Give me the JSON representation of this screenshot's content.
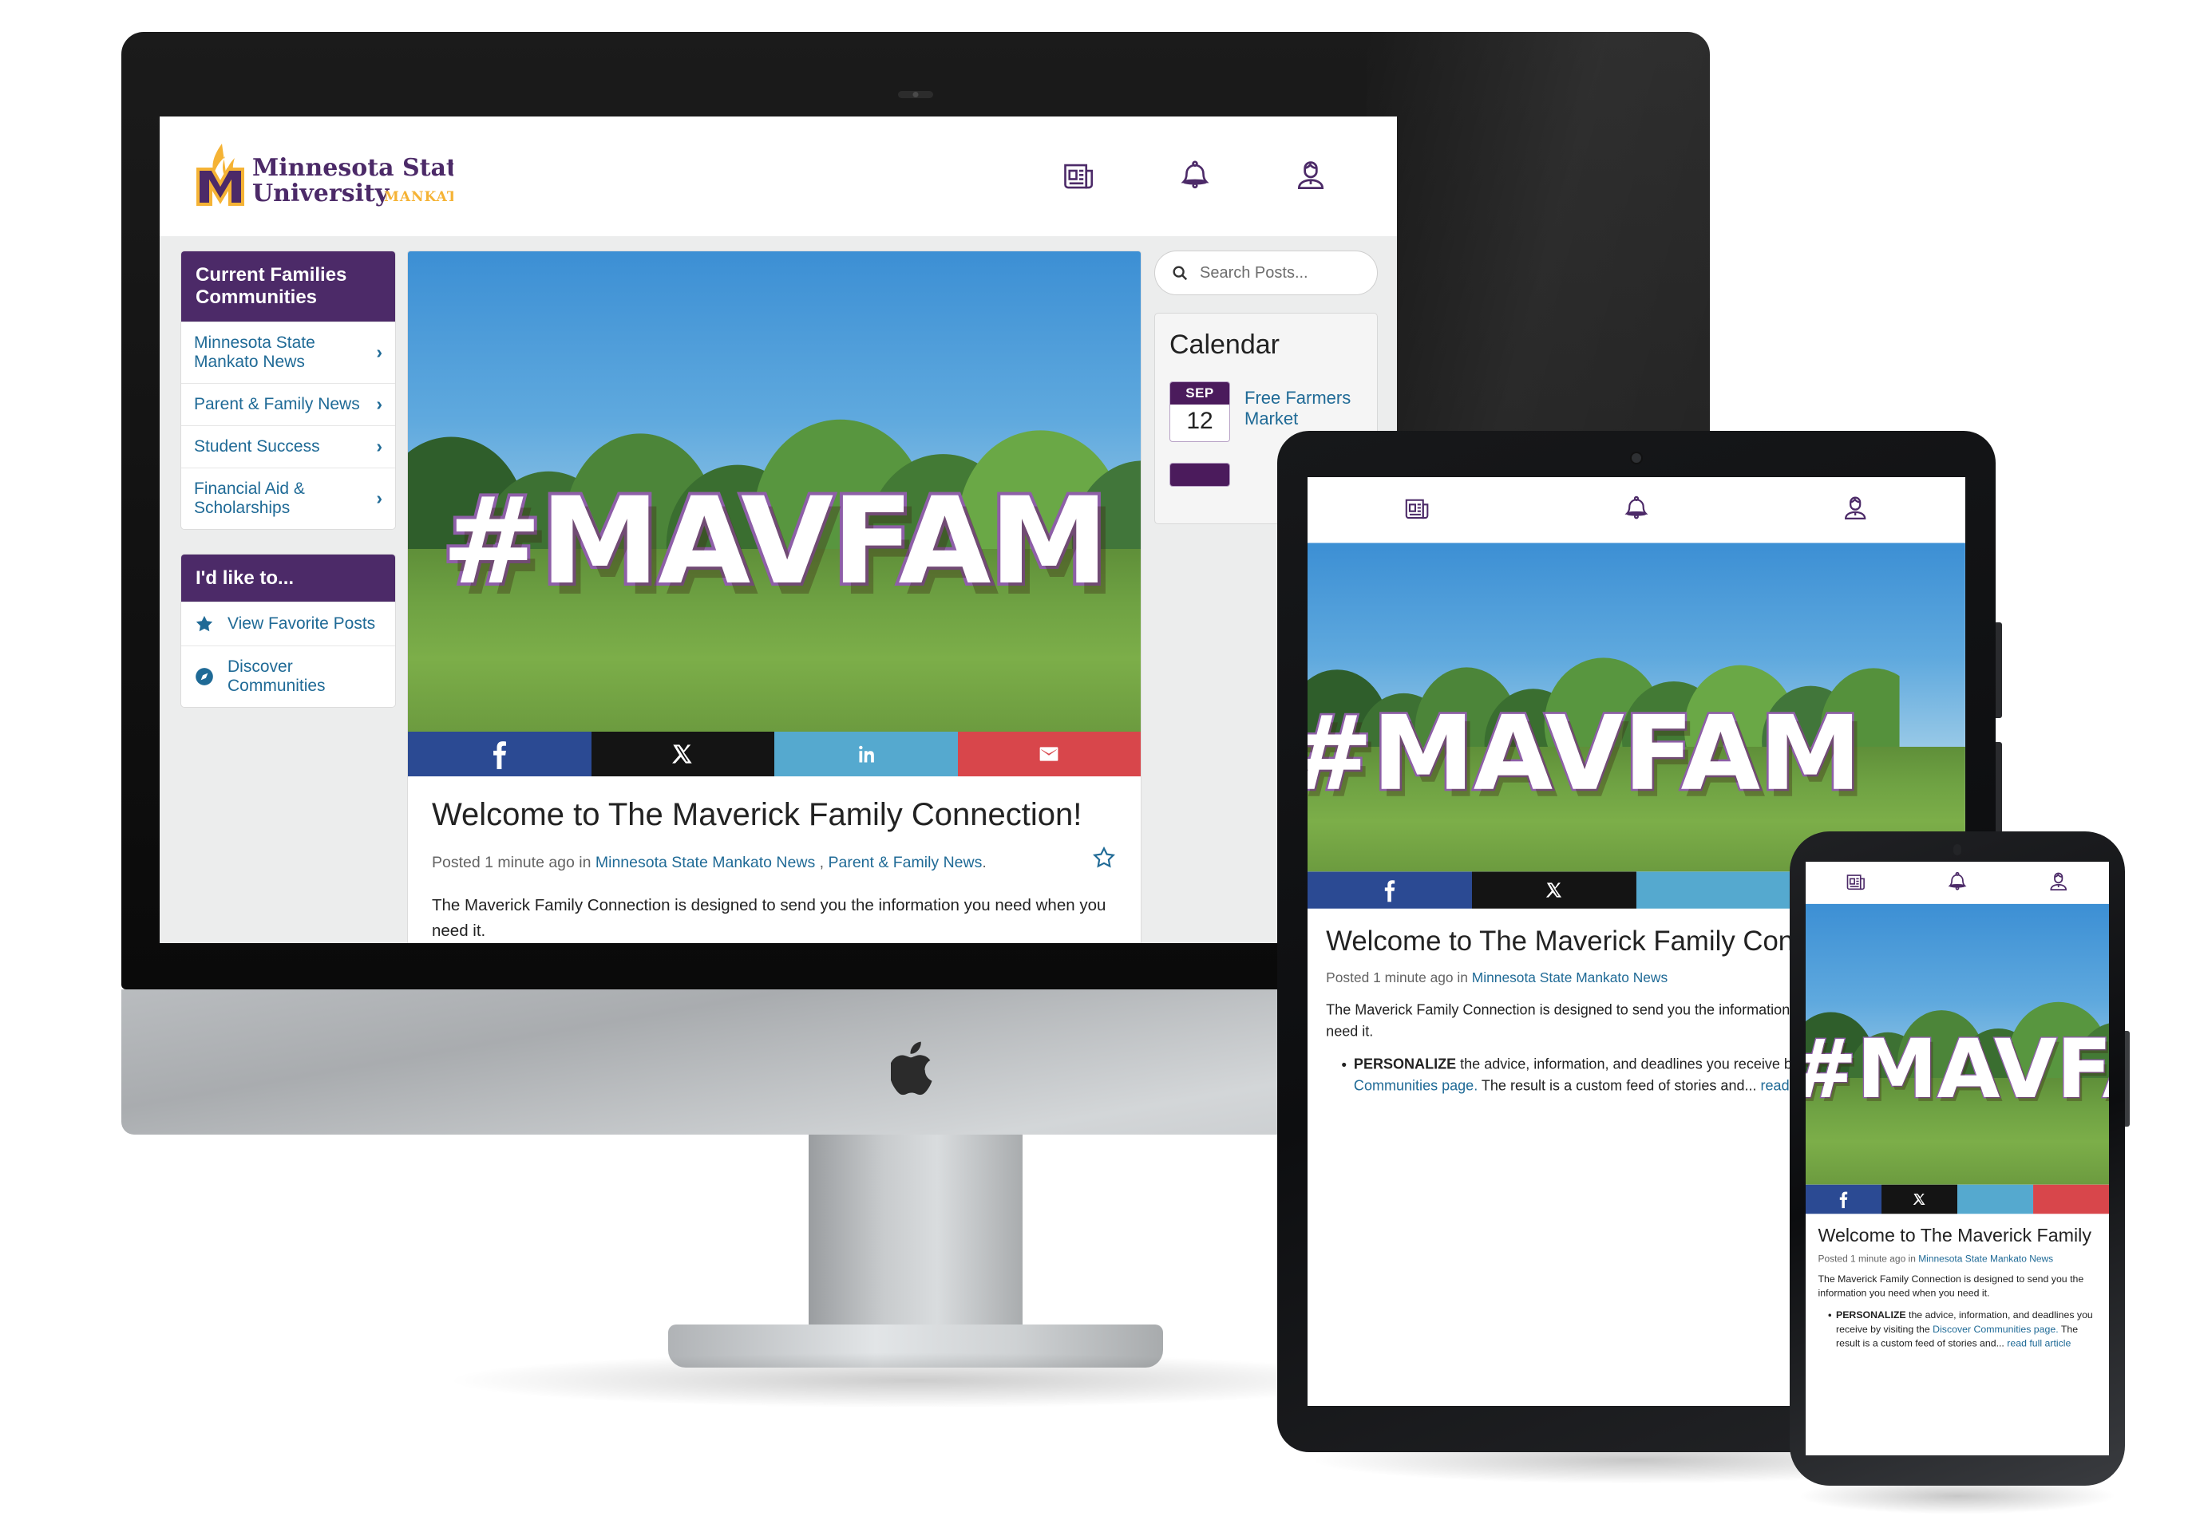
{
  "brand": {
    "name_line1": "Minnesota State",
    "name_line2": "University",
    "name_suffix": "MANKATO",
    "purple": "#4c2a68",
    "gold": "#f5b335",
    "link_blue": "#1f6a96"
  },
  "header": {
    "icons": [
      {
        "name": "news-icon",
        "label": "News"
      },
      {
        "name": "bell-icon",
        "label": "Notifications"
      },
      {
        "name": "profile-icon",
        "label": "Profile"
      }
    ]
  },
  "sidebar": {
    "communities": {
      "title": "Current Families Communities",
      "items": [
        {
          "label": "Minnesota State Mankato News",
          "chevron": "›"
        },
        {
          "label": "Parent & Family News",
          "chevron": "›"
        },
        {
          "label": "Student Success",
          "chevron": "›"
        },
        {
          "label": "Financial Aid & Scholarships",
          "chevron": "›"
        }
      ]
    },
    "actions": {
      "title": "I'd like to...",
      "items": [
        {
          "label": "View Favorite Posts",
          "icon": "star-icon"
        },
        {
          "label": "Discover Communities",
          "icon": "compass-icon"
        }
      ]
    }
  },
  "post": {
    "hero_text": "#MAVFAM",
    "share": [
      {
        "name": "facebook-share-button",
        "glyph": "f",
        "color": "#2b4a93"
      },
      {
        "name": "x-share-button",
        "glyph": "𝕏",
        "color": "#141414"
      },
      {
        "name": "linkedin-share-button",
        "glyph": "in",
        "color": "#55a9cf"
      },
      {
        "name": "email-share-button",
        "glyph": "✉",
        "color": "#d8464b"
      }
    ],
    "title": "Welcome to The Maverick Family Connection!",
    "meta_prefix": "Posted 1 minute ago in ",
    "meta_link1": "Minnesota State Mankato News",
    "meta_sep": " , ",
    "meta_link2": "Parent & Family News",
    "meta_end": ".",
    "body": "The Maverick Family Connection is designed to send you the information you need when you need it.",
    "bullet_bold": "PERSONALIZE",
    "bullet_text1": " the advice, information, and deadlines you receive by visiting the ",
    "bullet_link": "Discover Communities page.",
    "bullet_text2": " The result is a custom feed of stories and...",
    "read_more": "read full article",
    "favorite_icon": "star-outline-icon"
  },
  "search": {
    "placeholder": "Search Posts...",
    "icon": "search-icon"
  },
  "calendar": {
    "title": "Calendar",
    "events": [
      {
        "month": "SEP",
        "day": "12",
        "name": "Free Farmers Market"
      }
    ]
  }
}
